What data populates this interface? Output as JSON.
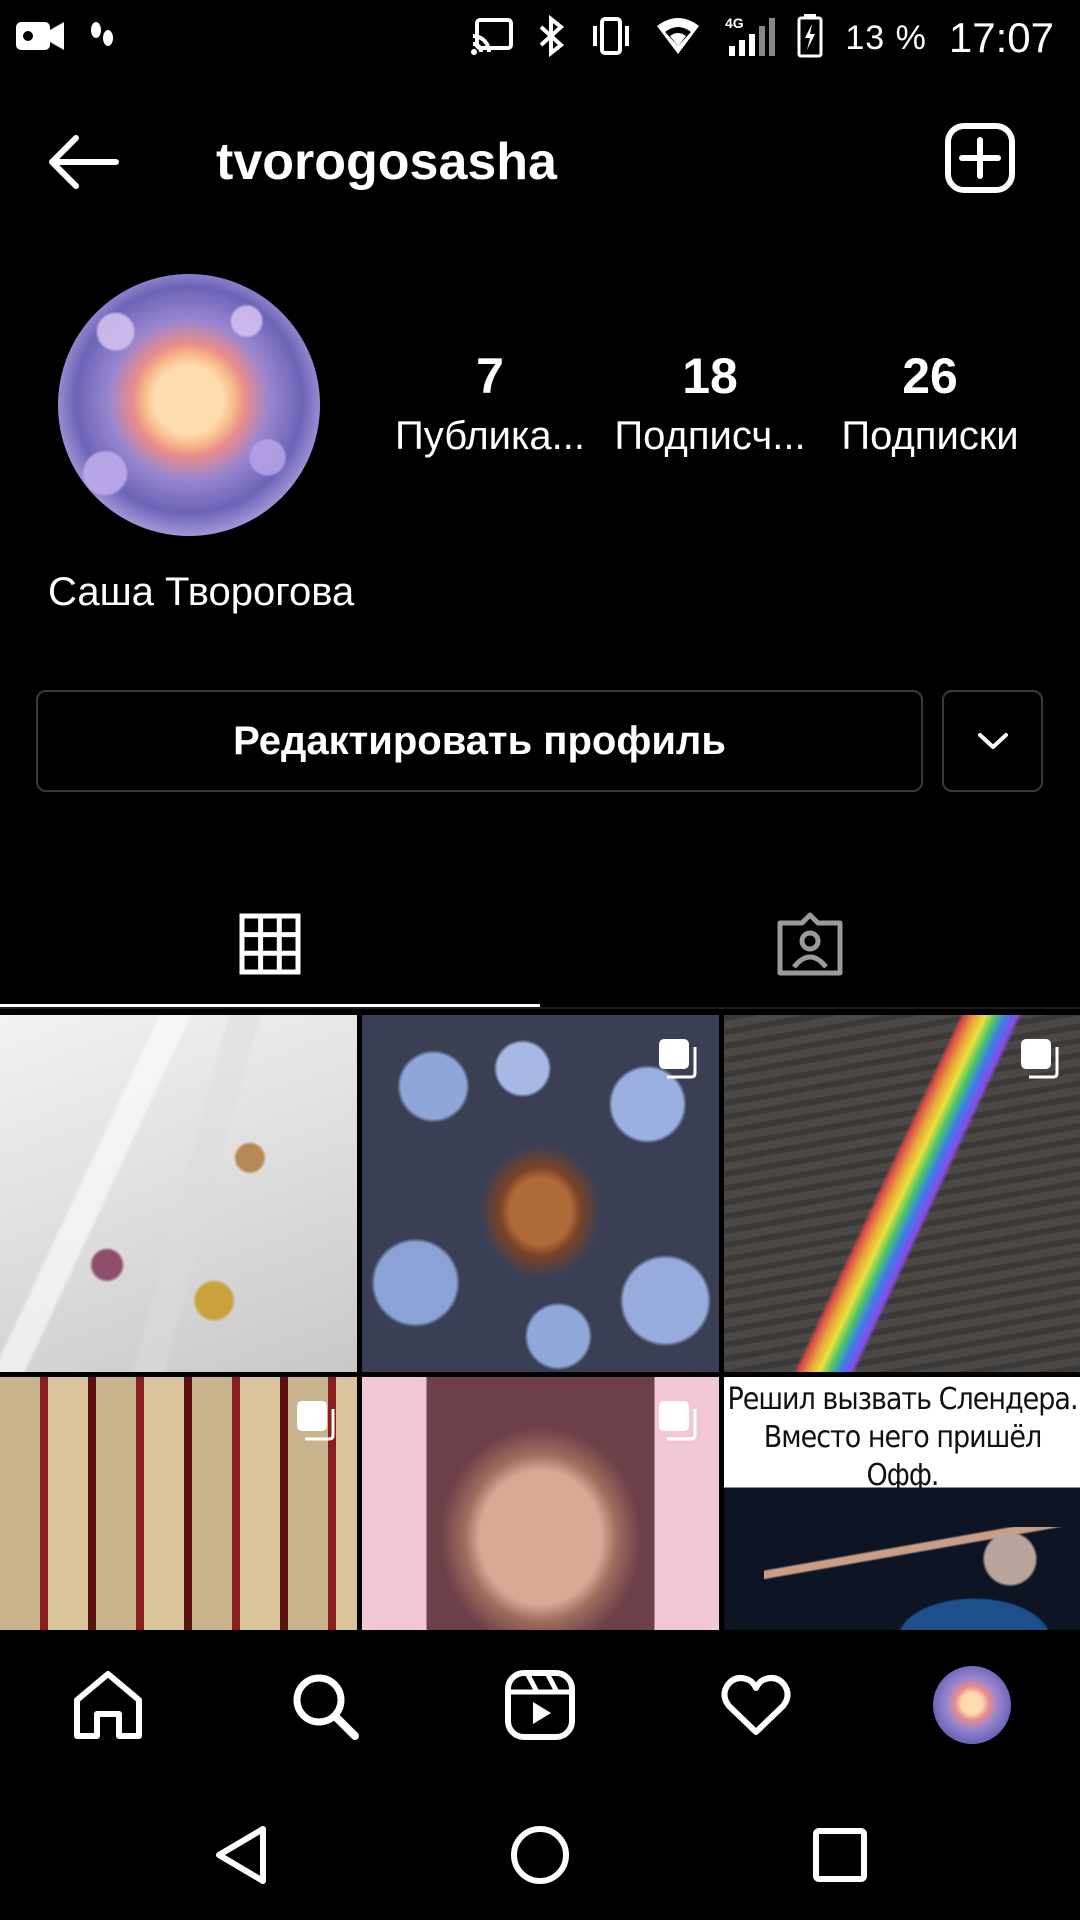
{
  "status_bar": {
    "battery_percent": "13 %",
    "time": "17:07",
    "network": "4G"
  },
  "header": {
    "username": "tvorogosasha"
  },
  "profile": {
    "display_name": "Саша Творогова",
    "stats": [
      {
        "value": "7",
        "label": "Публика..."
      },
      {
        "value": "18",
        "label": "Подписч..."
      },
      {
        "value": "26",
        "label": "Подписки"
      }
    ],
    "edit_button_label": "Редактировать профиль"
  },
  "tabs": [
    {
      "icon": "grid-icon",
      "active": true
    },
    {
      "icon": "tagged-person-icon",
      "active": false
    }
  ],
  "posts": [
    {
      "type": "photo",
      "multiple": false
    },
    {
      "type": "photo",
      "multiple": true
    },
    {
      "type": "photo",
      "multiple": true
    },
    {
      "type": "photo",
      "multiple": true
    },
    {
      "type": "photo",
      "multiple": true
    },
    {
      "type": "meme",
      "multiple": false,
      "caption": "Решил вызвать Слендера. Вместо него пришёл Офф."
    }
  ],
  "bottom_nav": [
    "home-icon",
    "search-icon",
    "reels-icon",
    "heart-icon",
    "profile-avatar"
  ],
  "colors": {
    "background": "#000000",
    "text": "#ffffff",
    "border": "#3a3a3a"
  }
}
